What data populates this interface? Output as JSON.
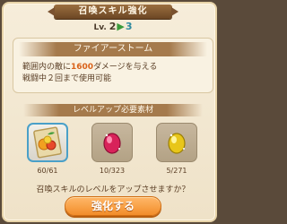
{
  "dialog": {
    "title": "召喚スキル強化",
    "level": {
      "label": "Lv.",
      "from": "2",
      "arrow": "▶",
      "to": "3"
    },
    "skill": {
      "name": "ファイアーストーム",
      "desc_line1_prefix": "範囲内の敵に",
      "desc_line1_value": "1600",
      "desc_line1_suffix": "ダメージを与える",
      "desc_line2": "戦闘中２回まで使用可能"
    },
    "materials": {
      "header": "レベルアップ必要素材",
      "items": [
        {
          "icon": "fruit-card-icon",
          "count": "60/61"
        },
        {
          "icon": "red-gem-icon",
          "count": "10/323"
        },
        {
          "icon": "yellow-gem-icon",
          "count": "5/271"
        }
      ]
    },
    "question": "召喚スキルのレベルをアップさせますか？",
    "confirm_label": "強化する"
  }
}
